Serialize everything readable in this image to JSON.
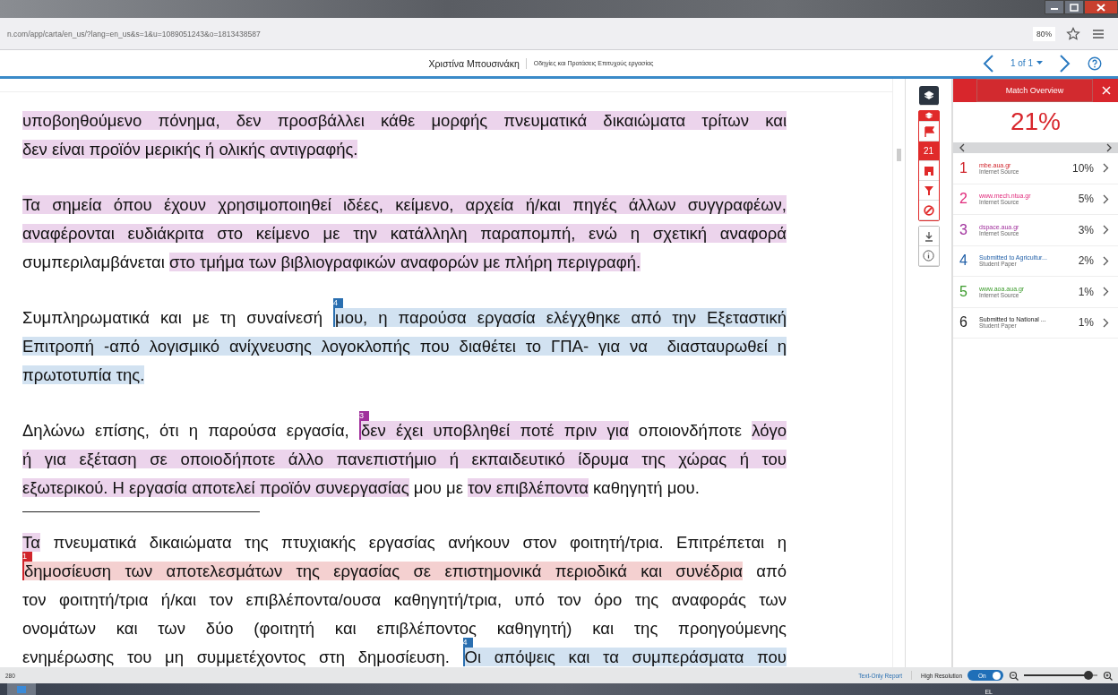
{
  "browser": {
    "url": "n.com/app/carta/en_us/?lang=en_us&s=1&u=1089051243&o=1813438587",
    "zoom": "80%"
  },
  "header": {
    "author": "Χριστίνα Μπουσινάκη",
    "title": "Οδηγίες και Προτάσεις Επιτυχούς εργασίας",
    "page": "1 of 1"
  },
  "document": {
    "blocks": [
      {
        "kind": "paragraph",
        "lines": [
          {
            "segments": [
              {
                "text": "υποβοηθούμενο πόνημα, δεν προσβάλλει κάθε μορφής πνευματικά δικαιώματα τρίτων και",
                "color": "#ecd4ec"
              }
            ]
          },
          {
            "segments": [
              {
                "text": "δεν είναι προϊόν μερικής ή ολικής αντιγραφής.",
                "color": "#ecd4ec"
              }
            ]
          }
        ]
      },
      {
        "kind": "paragraph",
        "lines": [
          {
            "segments": [
              {
                "text": "Τα σημεία όπου έχουν χρησιμοποιηθεί ιδέες, κείμενο, αρχεία ή/και πηγές άλλων συγγραφέων,",
                "color": "#ecd4ec"
              }
            ]
          },
          {
            "segments": [
              {
                "text": "αναφέρονται ευδιάκριτα στο κείμενο με την κατάλληλη παραπομπή, ενώ η σχετική αναφορά",
                "color": "#ecd4ec"
              }
            ]
          },
          {
            "segments": [
              {
                "text": "συμπεριλαμβάνεται "
              },
              {
                "text": "στο τμήμα των βιβλιογραφικών αναφορών με πλήρη περιγραφή.",
                "color": "#ecd4ec"
              }
            ]
          }
        ]
      },
      {
        "kind": "paragraph",
        "lines": [
          {
            "segments": [
              {
                "text": "Συμπληρωματικά και με τη συναίνεσή "
              },
              {
                "text": "μου, η παρούσα εργασία ελέγχθηκε από την Εξεταστική",
                "color": "#d2e2f1",
                "marker": {
                  "label": "4",
                  "color": "#2a6fb0"
                }
              }
            ]
          },
          {
            "segments": [
              {
                "text": "Επιτροπή -από λογισμικό ανίχνευσης λογοκλοπής που διαθέτει το ΓΠΑ- για να  διασταυρωθεί η",
                "color": "#d2e2f1"
              }
            ]
          },
          {
            "segments": [
              {
                "text": "πρωτοτυπία της.",
                "color": "#d2e2f1"
              }
            ]
          }
        ]
      },
      {
        "kind": "paragraph",
        "lines": [
          {
            "segments": [
              {
                "text": "Δηλώνω επίσης, ότι η παρούσα εργασία, "
              },
              {
                "text": "δεν έχει υποβληθεί ποτέ πριν για",
                "color": "#ecd4ec",
                "marker": {
                  "label": "3",
                  "color": "#a0309c"
                }
              },
              {
                "text": " οποιονδήποτε "
              },
              {
                "text": "λόγο",
                "color": "#ecd4ec"
              }
            ]
          },
          {
            "segments": [
              {
                "text": "ή για εξέταση σε οποιοδήποτε άλλο πανεπιστήμιο ή εκπαιδευτικό ίδρυμα της χώρας ή του",
                "color": "#ecd4ec"
              }
            ]
          },
          {
            "segments": [
              {
                "text": "εξωτερικού. Η εργασία αποτελεί προϊόν συνεργασίας",
                "color": "#ecd4ec"
              },
              {
                "text": " μου με "
              },
              {
                "text": "τον επιβλέποντα",
                "color": "#ecd4ec"
              },
              {
                "text": " καθηγητή μου."
              }
            ]
          }
        ]
      },
      {
        "kind": "rule"
      },
      {
        "kind": "paragraph",
        "continued": true,
        "lines": [
          {
            "segments": [
              {
                "text": "Τα",
                "color": "#ecd4ec"
              },
              {
                "text": " πνευματικά δικαιώματα της πτυχιακής εργασίας ανήκουν στον φοιτητή/τρια. Επιτρέπεται η"
              }
            ]
          },
          {
            "segments": [
              {
                "text": "δημοσίευση των αποτελεσμάτων της εργασίας σε επιστημονικά περιοδικά και συνέδρια",
                "color": "#f4d0d0",
                "marker": {
                  "label": "1",
                  "color": "#d0242b"
                }
              },
              {
                "text": " από"
              }
            ]
          },
          {
            "segments": [
              {
                "text": "τον φοιτητή/τρια ή/και τον επιβλέποντα/ουσα καθηγητή/τρια, υπό τον όρο της αναφοράς των"
              }
            ]
          },
          {
            "segments": [
              {
                "text": "ονομάτων και των δύο (φοιτητή και επιβλέποντος καθηγητή) και της προηγούμενης"
              }
            ]
          },
          {
            "segments": [
              {
                "text": "ενημέρωσης του μη συμμετέχοντος στη δημοσίευση. "
              },
              {
                "text": "Οι απόψεις και τα συμπεράσματα που",
                "color": "#d2e2f1",
                "marker": {
                  "label": "4",
                  "color": "#2a6fb0"
                }
              }
            ]
          }
        ]
      }
    ]
  },
  "toolbar": {
    "similarity": "21"
  },
  "match_overview": {
    "title": "Match Overview",
    "score": "21%",
    "sources": [
      {
        "number": "1",
        "name": "mbe.aua.gr",
        "type": "Internet Source",
        "percent": "10%",
        "color": "#d0242b"
      },
      {
        "number": "2",
        "name": "www.mech.ntua.gr",
        "type": "Internet Source",
        "percent": "5%",
        "color": "#e0287a"
      },
      {
        "number": "3",
        "name": "dspace.aua.gr",
        "type": "Internet Source",
        "percent": "3%",
        "color": "#a0309c"
      },
      {
        "number": "4",
        "name": "Submitted to Agricultur...",
        "type": "Student Paper",
        "percent": "2%",
        "color": "#2260a8"
      },
      {
        "number": "5",
        "name": "www.aoa.aua.gr",
        "type": "Internet Source",
        "percent": "1%",
        "color": "#3a9a2a"
      },
      {
        "number": "6",
        "name": "Submitted to National ...",
        "type": "Student Paper",
        "percent": "1%",
        "color": "#222222"
      }
    ]
  },
  "status_bar": {
    "page": "280",
    "text_only": "Text-Only Report",
    "high_resolution": {
      "label": "High Resolution",
      "on": true,
      "state_label": "On"
    },
    "zoom": {
      "level": 0.88
    }
  },
  "taskbar": {
    "language": "EL"
  }
}
